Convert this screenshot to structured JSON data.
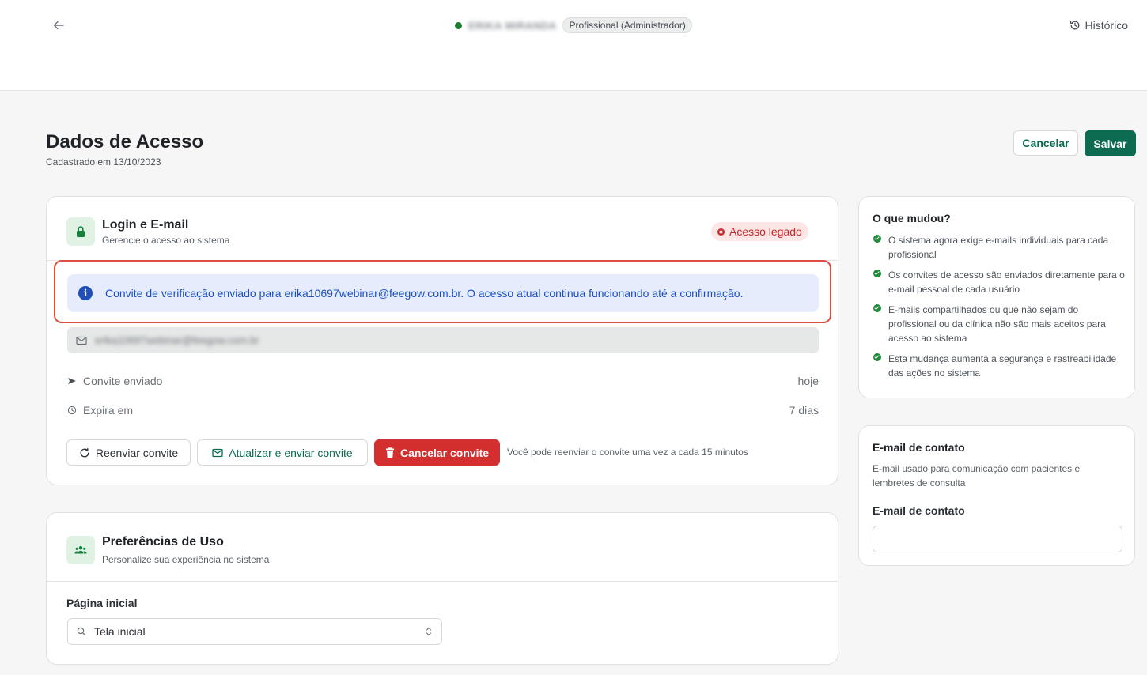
{
  "topbar": {
    "user_name": "ERIKA MIRANDA",
    "role": "Profissional (Administrador)",
    "history_label": "Histórico"
  },
  "header": {
    "title": "Dados de Acesso",
    "subtitle": "Cadastrado em 13/10/2023",
    "cancel_label": "Cancelar",
    "save_label": "Salvar"
  },
  "login": {
    "title": "Login e E-mail",
    "subtitle": "Gerencie o acesso ao sistema",
    "status_badge": "Acesso legado",
    "info_message": "Convite de verificação enviado para erika10697webinar@feegow.com.br. O acesso atual continua funcionando até a confirmação.",
    "email_value": "erika10697webinar@feegow.com.br",
    "invite_sent_label": "Convite enviado",
    "invite_sent_value": "hoje",
    "expires_label": "Expira em",
    "expires_value": "7 dias",
    "resend_label": "Reenviar convite",
    "update_label": "Atualizar e enviar convite",
    "cancel_invite_label": "Cancelar convite",
    "resend_hint": "Você pode reenviar o convite uma vez a cada 15 minutos"
  },
  "preferences": {
    "title": "Preferências de Uso",
    "subtitle": "Personalize sua experiência no sistema",
    "home_label": "Página inicial",
    "home_value": "Tela inicial"
  },
  "changes": {
    "title": "O que mudou?",
    "items": [
      "O sistema agora exige e-mails individuais para cada profissional",
      "Os convites de acesso são enviados diretamente para o e-mail pessoal de cada usuário",
      "E-mails compartilhados ou que não sejam do profissional ou da clínica não são mais aceitos para acesso ao sistema",
      "Esta mudança aumenta a segurança e rastreabilidade das ações no sistema"
    ]
  },
  "contact": {
    "title": "E-mail de contato",
    "description": "E-mail usado para comunicação com pacientes e lembretes de consulta",
    "field_label": "E-mail de contato",
    "field_value": ""
  },
  "colors": {
    "brand": "#0d6b52",
    "danger": "#d32f2f",
    "info": "#1c4fc3",
    "success": "#1e8a3a"
  },
  "icons": {
    "back": "arrow-left-icon",
    "history": "history-icon",
    "lock": "lock-icon",
    "info": "info-icon",
    "mail": "mail-icon",
    "send": "send-icon",
    "clock": "clock-icon",
    "refresh": "refresh-icon",
    "trash": "trash-icon",
    "users": "users-icon",
    "search": "search-icon",
    "check": "check-circle-icon"
  }
}
